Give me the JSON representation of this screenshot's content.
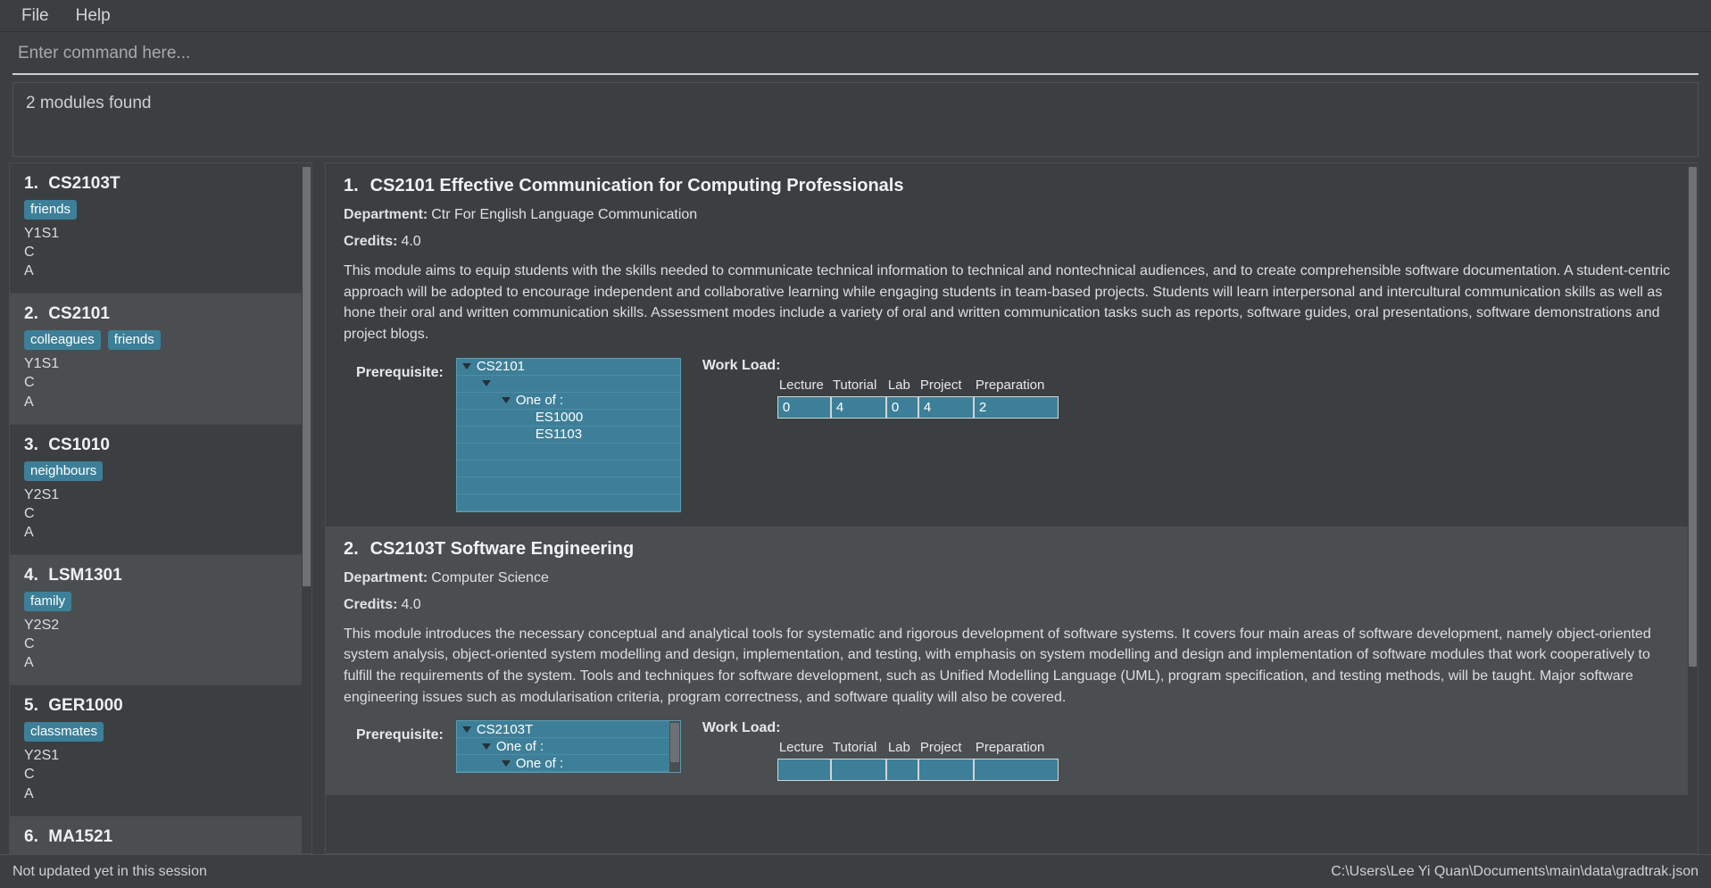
{
  "menu": {
    "items": [
      {
        "label": "File"
      },
      {
        "label": "Help"
      }
    ]
  },
  "command": {
    "placeholder": "Enter command here...",
    "value": ""
  },
  "result": {
    "message": "2 modules found"
  },
  "list_panel": {
    "items": [
      {
        "index": "1.",
        "code": "CS2103T",
        "tags": [
          "friends"
        ],
        "semester": "Y1S1",
        "line2": "C",
        "line3": "A"
      },
      {
        "index": "2.",
        "code": "CS2101",
        "tags": [
          "colleagues",
          "friends"
        ],
        "semester": "Y1S1",
        "line2": "C",
        "line3": "A"
      },
      {
        "index": "3.",
        "code": "CS1010",
        "tags": [
          "neighbours"
        ],
        "semester": "Y2S1",
        "line2": "C",
        "line3": "A"
      },
      {
        "index": "4.",
        "code": "LSM1301",
        "tags": [
          "family"
        ],
        "semester": "Y2S2",
        "line2": "C",
        "line3": "A"
      },
      {
        "index": "5.",
        "code": "GER1000",
        "tags": [
          "classmates"
        ],
        "semester": "Y2S1",
        "line2": "C",
        "line3": "A"
      },
      {
        "index": "6.",
        "code": "MA1521",
        "tags": [],
        "semester": "",
        "line2": "",
        "line3": ""
      }
    ]
  },
  "detail_panel": {
    "workload_headers": [
      "Lecture",
      "Tutorial",
      "Lab",
      "Project",
      "Preparation"
    ],
    "prerequisite_label": "Prerequisite:",
    "workload_label": "Work Load:",
    "department_label": "Department:",
    "credits_label": "Credits:",
    "modules": [
      {
        "index": "1.",
        "code": "CS2101",
        "name": "Effective Communication for Computing Professionals",
        "title": "1.  CS2101 Effective Communication for Computing Professionals",
        "department": "Ctr For English Language Communication",
        "credits": "4.0",
        "description": "This module aims to equip students with the skills needed to communicate technical information to technical and nontechnical audiences, and to create comprehensible software documentation. A student-centric approach will be adopted to encourage independent and collaborative learning while engaging students in team-based projects. Students will learn interpersonal and intercultural communication skills as well as hone their oral and written communication skills. Assessment modes include a variety of oral and written communication tasks such as reports, software guides, oral presentations, software demonstrations and project blogs.",
        "prerequisite_tree": [
          {
            "depth": 0,
            "label": "CS2101",
            "expandable": true
          },
          {
            "depth": 1,
            "label": "",
            "expandable": true
          },
          {
            "depth": 2,
            "label": "One of :",
            "expandable": true
          },
          {
            "depth": 3,
            "label": "ES1000",
            "expandable": false
          },
          {
            "depth": 3,
            "label": "ES1103",
            "expandable": false
          }
        ],
        "workload_values": [
          "0",
          "4",
          "0",
          "4",
          "2"
        ]
      },
      {
        "index": "2.",
        "code": "CS2103T",
        "name": "Software Engineering",
        "title": "2.  CS2103T Software Engineering",
        "department": "Computer Science",
        "credits": "4.0",
        "description": "This module introduces the necessary conceptual and analytical tools for systematic and rigorous development of software systems. It covers four main areas of software development, namely object-oriented system analysis, object-oriented system modelling and design, implementation, and testing, with emphasis on system modelling and design and implementation of software modules that work cooperatively to fulfill the requirements of the system. Tools and techniques for software development, such as Unified Modelling Language (UML), program specification, and testing methods, will be taught. Major software engineering issues such as modularisation criteria, program correctness, and software quality will also be covered.",
        "prerequisite_tree": [
          {
            "depth": 0,
            "label": "CS2103T",
            "expandable": true
          },
          {
            "depth": 1,
            "label": "One of :",
            "expandable": true
          },
          {
            "depth": 2,
            "label": "One of :",
            "expandable": true
          }
        ],
        "workload_values": [
          "",
          "",
          "",
          "",
          ""
        ]
      }
    ]
  },
  "statusbar": {
    "left": "Not updated yet in this session",
    "right": "C:\\Users\\Lee Yi Quan\\Documents\\main\\data\\gradtrak.json"
  },
  "colors": {
    "window_bg": "#3c3f41",
    "row_alt_bg": "#4a4e50",
    "accent": "#3d7f98",
    "text": "#e0e0e0"
  }
}
